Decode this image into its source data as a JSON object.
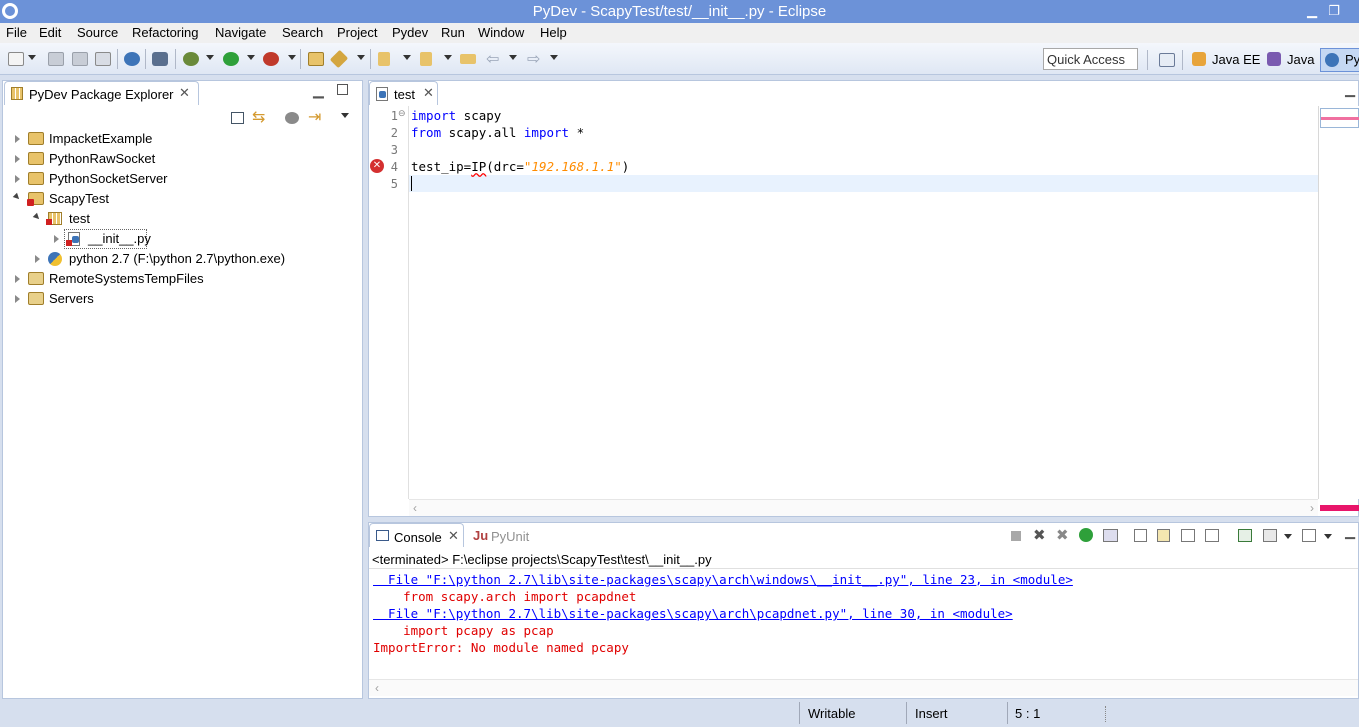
{
  "window": {
    "title": "PyDev - ScapyTest/test/__init__.py - Eclipse",
    "minimize": "▁",
    "restore": "❐"
  },
  "menu": [
    "File",
    "Edit",
    "Source",
    "Refactoring",
    "Navigate",
    "Search",
    "Project",
    "Pydev",
    "Run",
    "Window",
    "Help"
  ],
  "toolbar": {
    "quick_access_placeholder": "Quick Access",
    "perspectives": [
      "Java EE",
      "Java",
      "Py"
    ]
  },
  "explorer": {
    "tab_label": "PyDev Package Explorer",
    "items": [
      {
        "label": "ImpacketExample"
      },
      {
        "label": "PythonRawSocket"
      },
      {
        "label": "PythonSocketServer"
      },
      {
        "label": "ScapyTest"
      },
      {
        "label": "test"
      },
      {
        "label": "__init__.py"
      },
      {
        "label": "python 2.7  (F:\\python 2.7\\python.exe)"
      },
      {
        "label": "RemoteSystemsTempFiles"
      },
      {
        "label": "Servers"
      }
    ]
  },
  "editor": {
    "tab_label": "test",
    "line_numbers": [
      "1",
      "2",
      "3",
      "4",
      "5"
    ],
    "lines": {
      "l1_kw": "import",
      "l1_rest": " scapy",
      "l2_kw1": "from",
      "l2_mid": " scapy.all ",
      "l2_kw2": "import",
      "l2_rest": " *",
      "l4_a": "test_ip=",
      "l4_err": "IP",
      "l4_b": "(drc=",
      "l4_str": "\"192.168.1.1\"",
      "l4_c": ")"
    }
  },
  "console": {
    "tab_label": "Console",
    "pyunit_label": "PyUnit",
    "terminated": "<terminated> F:\\eclipse projects\\ScapyTest\\test\\__init__.py",
    "lines": [
      "  File \"F:\\python 2.7\\lib\\site-packages\\scapy\\arch\\windows\\__init__.py\", line 23, in <module>",
      "    from scapy.arch import pcapdnet",
      "  File \"F:\\python 2.7\\lib\\site-packages\\scapy\\arch\\pcapdnet.py\", line 30, in <module>",
      "    import pcapy as pcap",
      "ImportError: No module named pcapy"
    ]
  },
  "status": {
    "writable": "Writable",
    "insert": "Insert",
    "position": "5 : 1"
  },
  "colors": {
    "titlebar": "#6c92d8",
    "keyword": "#0000ff",
    "string": "#ff8c00",
    "error": "#e00000",
    "link": "#0000ff"
  }
}
